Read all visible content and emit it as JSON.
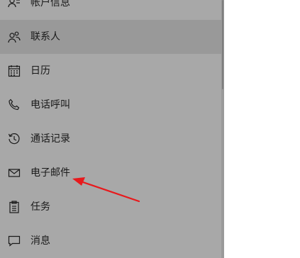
{
  "sidebar": {
    "items": [
      {
        "id": "account-info",
        "label": "帐户信息",
        "icon": "person-card-icon",
        "selected": false
      },
      {
        "id": "contacts",
        "label": "联系人",
        "icon": "people-icon",
        "selected": true
      },
      {
        "id": "calendar",
        "label": "日历",
        "icon": "calendar-icon",
        "selected": false
      },
      {
        "id": "call-history-phone",
        "label": "电话呼叫",
        "icon": "phone-icon",
        "selected": false
      },
      {
        "id": "call-history",
        "label": "通话记录",
        "icon": "history-icon",
        "selected": false
      },
      {
        "id": "email",
        "label": "电子邮件",
        "icon": "mail-icon",
        "selected": false
      },
      {
        "id": "tasks",
        "label": "任务",
        "icon": "clipboard-icon",
        "selected": false
      },
      {
        "id": "messages",
        "label": "消息",
        "icon": "message-icon",
        "selected": false
      }
    ]
  },
  "colors": {
    "sidebar_bg": "#a8a8a8",
    "selected_bg": "#999999",
    "text": "#1a1a1a",
    "annotation_arrow": "#e8191c"
  },
  "annotation": {
    "type": "arrow",
    "target": "email",
    "color": "#e8191c"
  }
}
